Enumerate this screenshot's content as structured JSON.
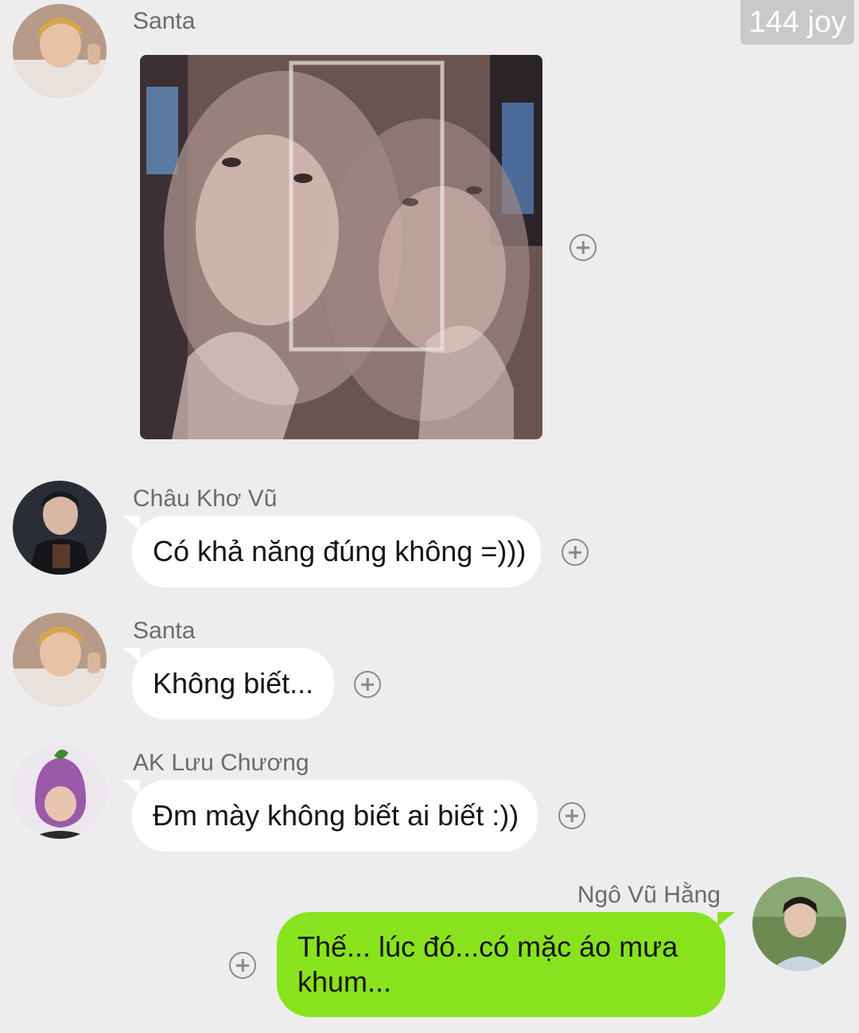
{
  "watermark": "144 joy",
  "messages": [
    {
      "sender": "Santa",
      "type": "image",
      "image_alt": "photo"
    },
    {
      "sender": "Châu Khơ Vũ",
      "type": "text",
      "text": "Có khả năng đúng không =)))"
    },
    {
      "sender": "Santa",
      "type": "text",
      "text": "Không biết..."
    },
    {
      "sender": "AK Lưu Chương",
      "type": "text",
      "text": "Đm mày không biết ai biết :))"
    },
    {
      "sender": "Ngô Vũ Hằng",
      "type": "text",
      "direction": "outgoing",
      "text": "Thế... lúc đó...có mặc áo mưa khum..."
    }
  ],
  "colors": {
    "background": "#ededed",
    "incoming_bubble": "#ffffff",
    "outgoing_bubble": "#88e31e"
  },
  "icons": {
    "react": "add-reaction-icon"
  }
}
